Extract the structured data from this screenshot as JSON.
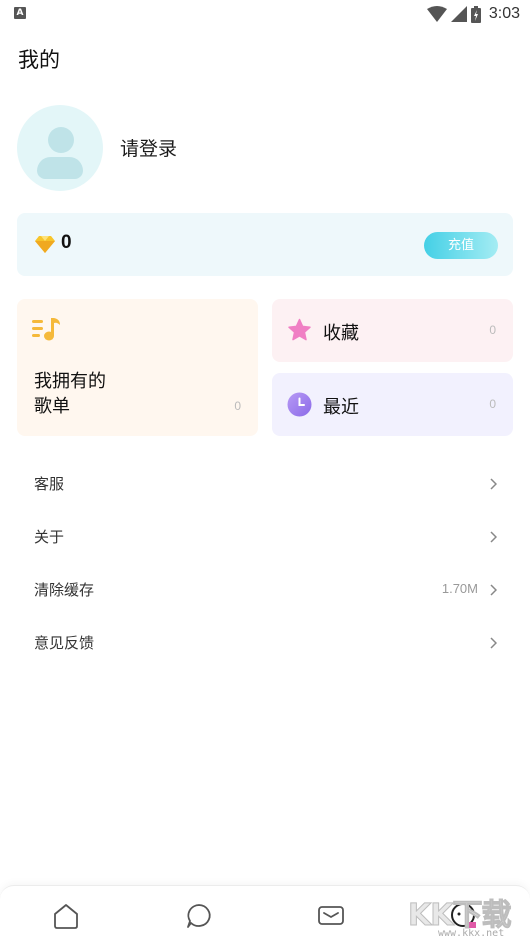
{
  "status_bar": {
    "app_icon": "A",
    "time": "3:03",
    "icons": [
      "wifi-icon",
      "signal-icon",
      "battery-icon"
    ]
  },
  "page": {
    "title": "我的"
  },
  "profile": {
    "login_text": "请登录",
    "avatar_icon": "avatar-placeholder-icon"
  },
  "balance": {
    "value": "0",
    "icon": "diamond-icon",
    "recharge_label": "充值",
    "accent_color": "#44d0e6"
  },
  "cards": {
    "playlist": {
      "title": "我拥有的\n歌单",
      "count": "0",
      "icon": "music-note-icon",
      "bg": "#fff7ef"
    },
    "favorites": {
      "label": "收藏",
      "count": "0",
      "icon": "star-icon",
      "bg": "#fdf1f3"
    },
    "recent": {
      "label": "最近",
      "count": "0",
      "icon": "clock-icon",
      "bg": "#f2f1fe"
    }
  },
  "menu": {
    "items": [
      {
        "label": "客服",
        "value": ""
      },
      {
        "label": "关于",
        "value": ""
      },
      {
        "label": "清除缓存",
        "value": "1.70M"
      },
      {
        "label": "意见反馈",
        "value": ""
      }
    ]
  },
  "bottom_nav": {
    "items": [
      "home-icon",
      "chat-icon",
      "message-icon",
      "profile-face-icon"
    ]
  },
  "watermark": {
    "text": "KK下载",
    "url": "www.kkx.net"
  }
}
